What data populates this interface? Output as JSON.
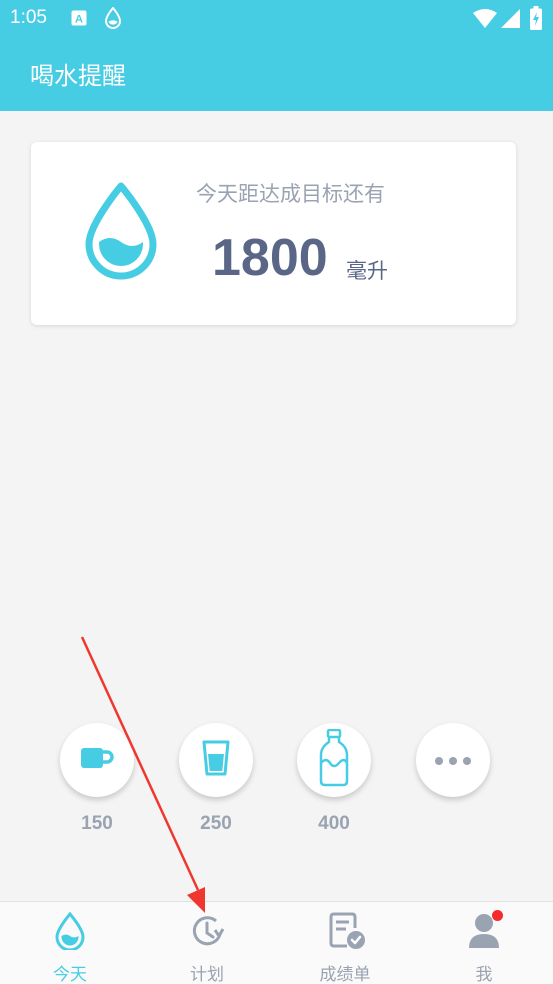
{
  "status_bar": {
    "time": "1:05",
    "icons": [
      "notification-a-icon",
      "water-drop-icon",
      "wifi-icon",
      "signal-icon",
      "battery-charging-icon"
    ]
  },
  "app_bar": {
    "title": "喝水提醒"
  },
  "goal_card": {
    "title": "今天距达成目标还有",
    "value": "1800",
    "unit": "毫升",
    "icon": "water-drop-icon"
  },
  "quick_add": [
    {
      "label": "150",
      "icon": "coffee-cup-icon"
    },
    {
      "label": "250",
      "icon": "glass-icon"
    },
    {
      "label": "400",
      "icon": "bottle-icon"
    },
    {
      "label": "",
      "icon": "more-icon"
    }
  ],
  "tabs": [
    {
      "label": "今天",
      "icon": "water-drop-icon",
      "active": true
    },
    {
      "label": "计划",
      "icon": "clock-refresh-icon",
      "active": false
    },
    {
      "label": "成绩单",
      "icon": "report-check-icon",
      "active": false
    },
    {
      "label": "我",
      "icon": "user-icon",
      "active": false,
      "badge": true
    }
  ],
  "colors": {
    "primary": "#47cde3",
    "text_dark": "#5a6686",
    "text_muted": "#9aa3b2",
    "badge": "#f52a2a",
    "annotation_arrow": "#f0372f"
  }
}
